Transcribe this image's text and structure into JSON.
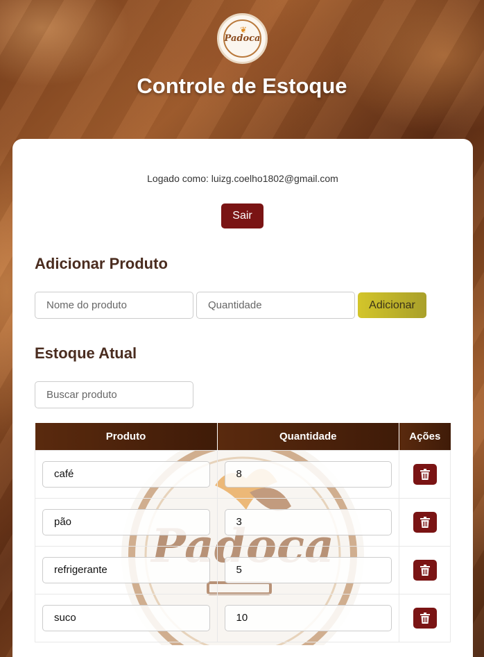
{
  "header": {
    "logo_text": "Padoca",
    "title": "Controle de Estoque"
  },
  "session": {
    "logged_in_as": "Logado como: luizg.coelho1802@gmail.com",
    "logout_label": "Sair"
  },
  "add_product": {
    "heading": "Adicionar Produto",
    "name_placeholder": "Nome do produto",
    "quantity_placeholder": "Quantidade",
    "add_label": "Adicionar"
  },
  "stock": {
    "heading": "Estoque Atual",
    "search_placeholder": "Buscar produto",
    "columns": [
      "Produto",
      "Quantidade",
      "Ações"
    ],
    "rows": [
      {
        "product": "café",
        "quantity": "8"
      },
      {
        "product": "pão",
        "quantity": "3"
      },
      {
        "product": "refrigerante",
        "quantity": "5"
      },
      {
        "product": "suco",
        "quantity": "10"
      }
    ]
  },
  "colors": {
    "primary": "#7a1414",
    "accent": "#d3c52a",
    "table_header": "#5a2a0e",
    "heading_text": "#4a2c1f"
  },
  "icons": {
    "delete": "trash-icon"
  }
}
